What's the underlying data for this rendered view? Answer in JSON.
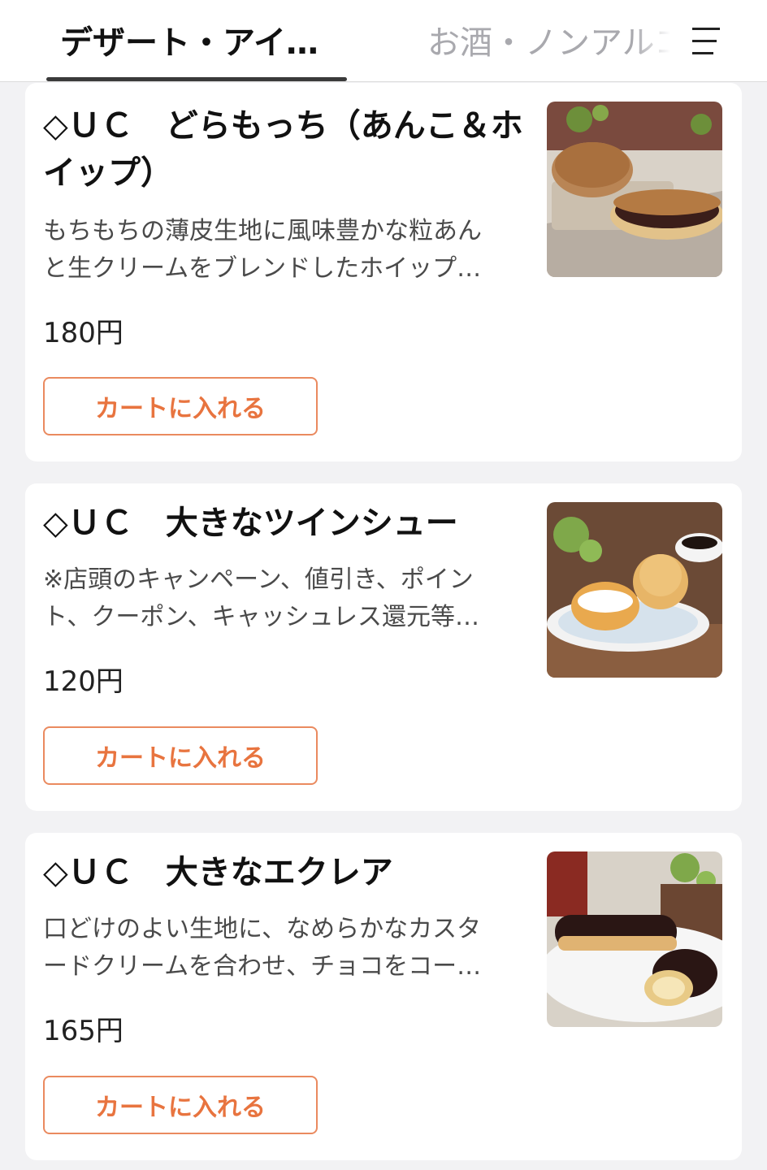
{
  "tabs": {
    "active_label": "デザート・アイ…",
    "next_label": "お酒・ノンアルコール"
  },
  "menu": {
    "icon": "hamburger-menu-icon"
  },
  "colors": {
    "accent": "#e8743f",
    "accent_border": "#ea8a5f",
    "background": "#f2f2f4"
  },
  "products": [
    {
      "title": "◇ＵＣ　どらもっち（あんこ＆ホイップ）",
      "description": "もちもちの薄皮生地に風味豊かな粒あん\nと生クリームをブレンドしたホイップ…",
      "price": "180円",
      "cart_label": "カートに入れる"
    },
    {
      "title": "◇ＵＣ　大きなツインシュー",
      "description": "※店頭のキャンペーン、値引き、ポイン\nト、クーポン、キャッシュレス還元等…",
      "price": "120円",
      "cart_label": "カートに入れる"
    },
    {
      "title": "◇ＵＣ　大きなエクレア",
      "description": "口どけのよい生地に、なめらかなカスタ\nードクリームを合わせ、チョコをコー…",
      "price": "165円",
      "cart_label": "カートに入れる"
    }
  ]
}
